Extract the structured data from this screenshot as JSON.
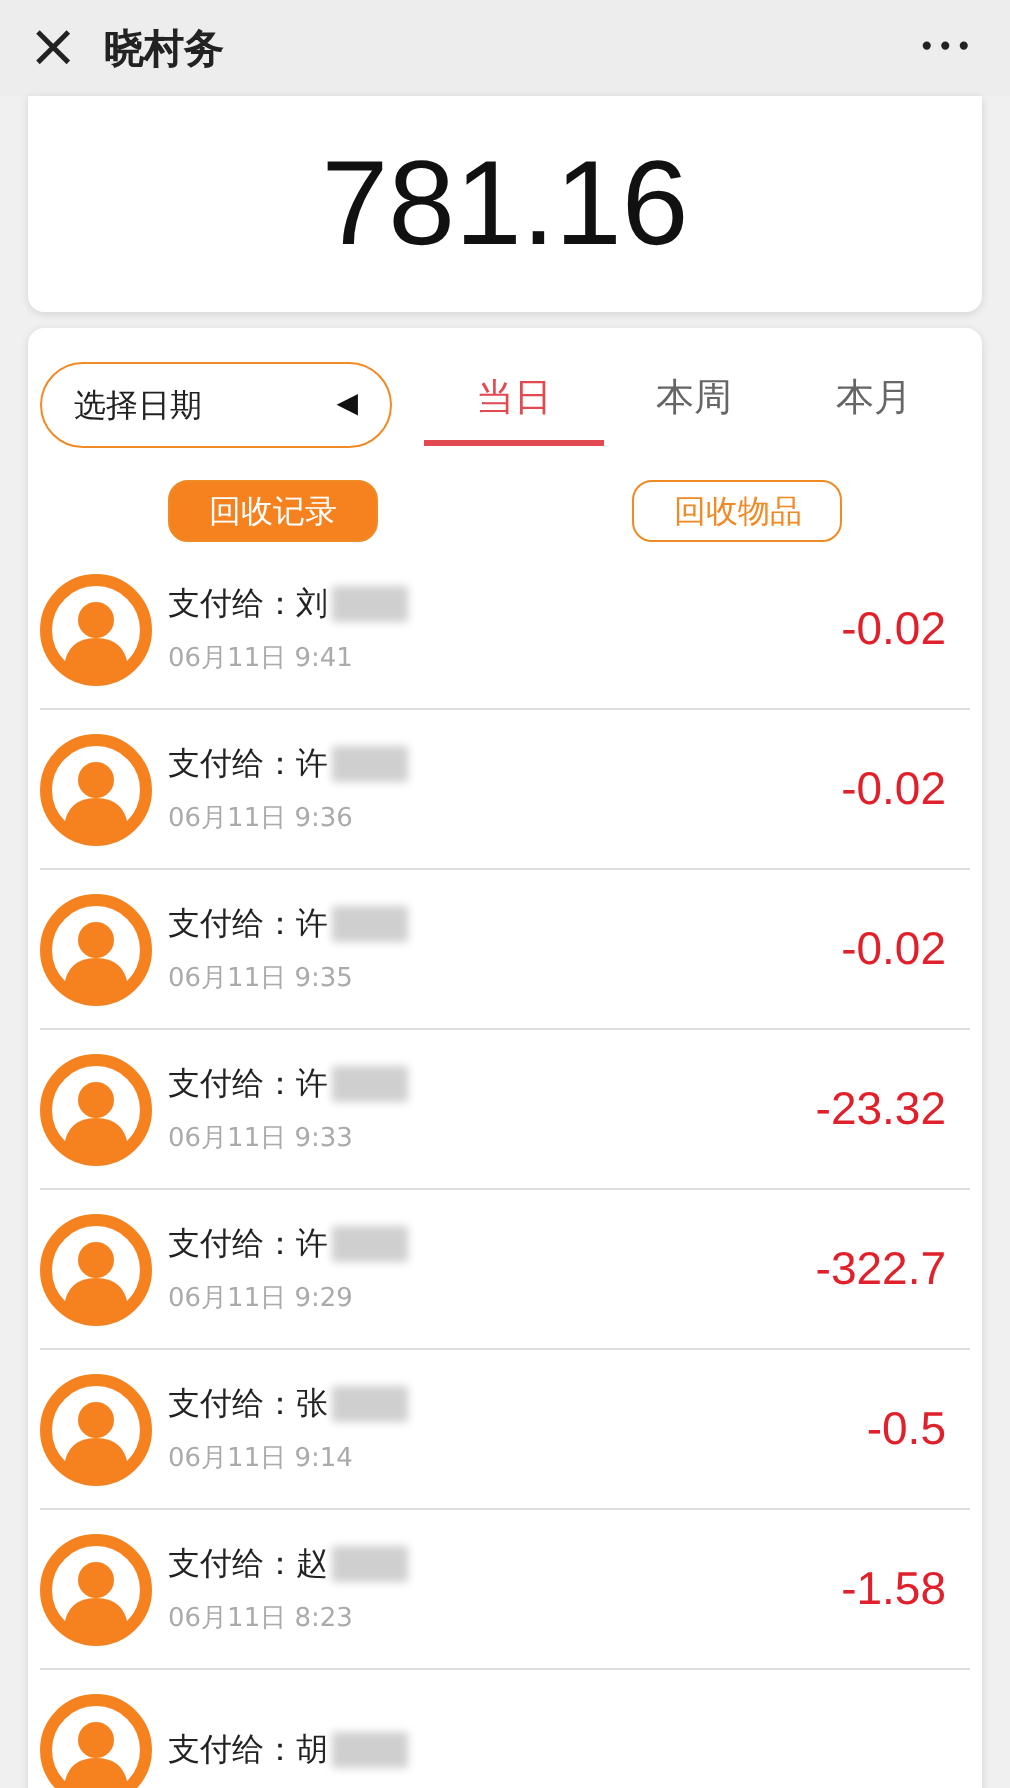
{
  "header": {
    "close": "×",
    "title": "晓村务",
    "more": "•••"
  },
  "total": "781.16",
  "date_picker": {
    "label": "选择日期",
    "caret": "◀"
  },
  "tabs": [
    {
      "label": "当日",
      "selected": true
    },
    {
      "label": "本周",
      "selected": false
    },
    {
      "label": "本月",
      "selected": false
    }
  ],
  "sub_tabs": [
    {
      "label": "回收记录",
      "selected": true
    },
    {
      "label": "回收物品",
      "selected": false
    }
  ],
  "records": [
    {
      "title": "支付给：刘",
      "redacted": true,
      "date": "06月11日 9:41",
      "amount": "-0.02"
    },
    {
      "title": "支付给：许",
      "redacted": true,
      "date": "06月11日 9:36",
      "amount": "-0.02"
    },
    {
      "title": "支付给：许",
      "redacted": true,
      "date": "06月11日 9:35",
      "amount": "-0.02"
    },
    {
      "title": "支付给：许",
      "redacted": true,
      "date": "06月11日 9:33",
      "amount": "-23.32"
    },
    {
      "title": "支付给：许",
      "redacted": true,
      "date": "06月11日 9:29",
      "amount": "-322.7"
    },
    {
      "title": "支付给：张",
      "redacted": true,
      "date": "06月11日 9:14",
      "amount": "-0.5"
    },
    {
      "title": "支付给：赵",
      "redacted": true,
      "date": "06月11日 8:23",
      "amount": "-1.58"
    },
    {
      "title": "支付给：胡",
      "redacted": true
    }
  ]
}
